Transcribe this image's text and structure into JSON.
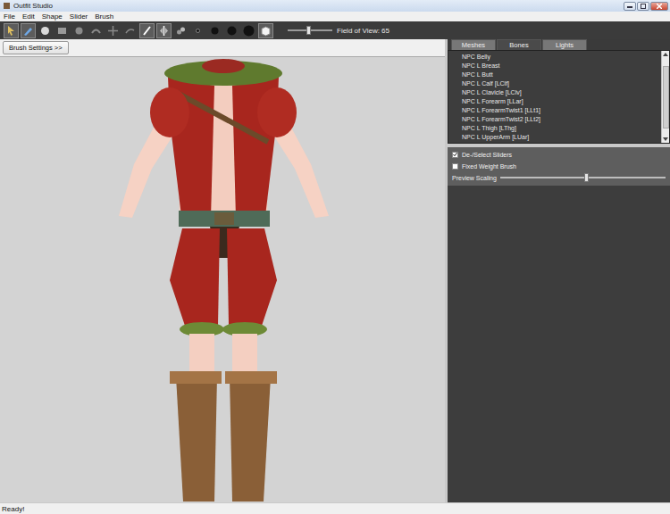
{
  "window": {
    "title": "Outfit Studio"
  },
  "menu": [
    "File",
    "Edit",
    "Shape",
    "Slider",
    "Brush"
  ],
  "toolbar": {
    "tools": [
      {
        "kind": "select",
        "selected": true
      },
      {
        "kind": "brush",
        "selected": true
      },
      {
        "kind": "mask",
        "selected": false
      },
      {
        "kind": "unmask",
        "selected": false
      },
      {
        "kind": "inflate",
        "selected": false
      },
      {
        "kind": "deflate",
        "selected": false
      },
      {
        "kind": "move",
        "selected": false
      },
      {
        "kind": "smooth",
        "selected": false
      },
      {
        "kind": "weight",
        "selected": true
      },
      {
        "kind": "mirror",
        "selected": true
      },
      {
        "kind": "link",
        "selected": false
      },
      {
        "kind": "dot-small",
        "selected": false
      },
      {
        "kind": "dot-medium",
        "selected": false
      },
      {
        "kind": "dot-large",
        "selected": false
      },
      {
        "kind": "dot-xlarge",
        "selected": false
      },
      {
        "kind": "cube",
        "selected": true
      }
    ],
    "field_of_view": {
      "label": "Field of View: 65",
      "level": 0.45
    }
  },
  "viewport": {
    "brush_settings_button": "Brush Settings >>"
  },
  "tabs": [
    {
      "label": "Meshes",
      "selected": false
    },
    {
      "label": "Bones",
      "selected": true
    },
    {
      "label": "Lights",
      "selected": false
    }
  ],
  "bones": [
    {
      "label": "NPC Belly",
      "selected": false
    },
    {
      "label": "NPC L Breast",
      "selected": false
    },
    {
      "label": "NPC L Butt",
      "selected": false
    },
    {
      "label": "NPC L Calf [LClf]",
      "selected": false
    },
    {
      "label": "NPC L Clavicle [LClv]",
      "selected": false
    },
    {
      "label": "NPC L Forearm [LLar]",
      "selected": false
    },
    {
      "label": "NPC L ForearmTwist1 [LLt1]",
      "selected": false
    },
    {
      "label": "NPC L ForearmTwist2 [LLt2]",
      "selected": false
    },
    {
      "label": "NPC L Thigh [LThg]",
      "selected": false
    },
    {
      "label": "NPC L UpperArm [LUar]",
      "selected": false
    }
  ],
  "options": [
    {
      "kind": "checkbox",
      "label": "De-/Select Sliders",
      "checked": true
    },
    {
      "kind": "checkbox",
      "label": "Fixed Weight Brush",
      "checked": false
    },
    {
      "kind": "slider",
      "label": "Preview Scaling",
      "level": 0.52
    }
  ],
  "status_bar": "Ready!"
}
